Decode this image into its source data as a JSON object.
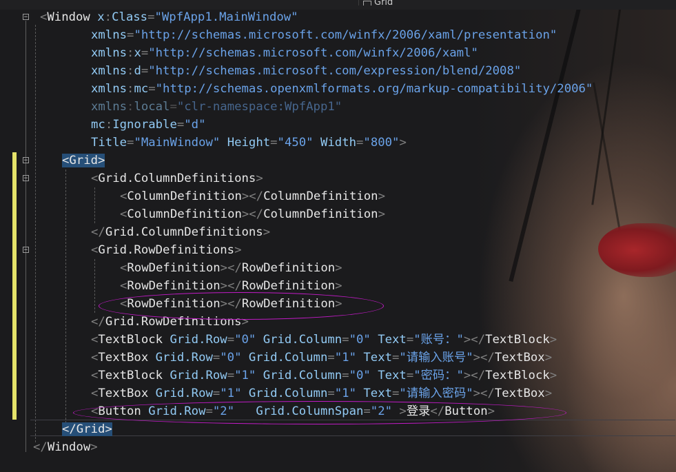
{
  "tab": {
    "icon": "grid-icon",
    "label": "Grid"
  },
  "code": [
    [
      [
        "p",
        "<"
      ],
      [
        "t",
        "Window "
      ],
      [
        "a",
        "x"
      ],
      [
        "p",
        ":"
      ],
      [
        "a",
        "Class"
      ],
      [
        "p",
        "="
      ],
      [
        "s",
        "\"WpfApp1.MainWindow\""
      ]
    ],
    [
      [
        "a",
        "xmlns"
      ],
      [
        "p",
        "="
      ],
      [
        "s",
        "\"http://schemas.microsoft.com/winfx/2006/xaml/presentation\""
      ]
    ],
    [
      [
        "a",
        "xmlns"
      ],
      [
        "p",
        ":"
      ],
      [
        "a",
        "x"
      ],
      [
        "p",
        "="
      ],
      [
        "s",
        "\"http://schemas.microsoft.com/winfx/2006/xaml\""
      ]
    ],
    [
      [
        "a",
        "xmlns"
      ],
      [
        "p",
        ":"
      ],
      [
        "a",
        "d"
      ],
      [
        "p",
        "="
      ],
      [
        "s",
        "\"http://schemas.microsoft.com/expression/blend/2008\""
      ]
    ],
    [
      [
        "a",
        "xmlns"
      ],
      [
        "p",
        ":"
      ],
      [
        "a",
        "mc"
      ],
      [
        "p",
        "="
      ],
      [
        "s",
        "\"http://schemas.openxmlformats.org/markup-compatibility/2006\""
      ]
    ],
    [
      [
        "a",
        "xmlns"
      ],
      [
        "p",
        ":"
      ],
      [
        "a",
        "local"
      ],
      [
        "p",
        "="
      ],
      [
        "s",
        "\"clr-namespace:WpfApp1\""
      ]
    ],
    [
      [
        "a",
        "mc"
      ],
      [
        "p",
        ":"
      ],
      [
        "a",
        "Ignorable"
      ],
      [
        "p",
        "="
      ],
      [
        "s",
        "\"d\""
      ]
    ],
    [
      [
        "a",
        "Title"
      ],
      [
        "p",
        "="
      ],
      [
        "s",
        "\"MainWindow\""
      ],
      [
        "a",
        " Height"
      ],
      [
        "p",
        "="
      ],
      [
        "s",
        "\"450\""
      ],
      [
        "a",
        " Width"
      ],
      [
        "p",
        "="
      ],
      [
        "s",
        "\"800\""
      ],
      [
        "p",
        ">"
      ]
    ],
    [
      [
        "hl",
        "<Grid>"
      ]
    ],
    [
      [
        "p",
        "<"
      ],
      [
        "t",
        "Grid.ColumnDefinitions"
      ],
      [
        "p",
        ">"
      ]
    ],
    [
      [
        "p",
        "<"
      ],
      [
        "t",
        "ColumnDefinition"
      ],
      [
        "p",
        "></"
      ],
      [
        "t",
        "ColumnDefinition"
      ],
      [
        "p",
        ">"
      ]
    ],
    [
      [
        "p",
        "<"
      ],
      [
        "t",
        "ColumnDefinition"
      ],
      [
        "p",
        "></"
      ],
      [
        "t",
        "ColumnDefinition"
      ],
      [
        "p",
        ">"
      ]
    ],
    [
      [
        "p",
        "</"
      ],
      [
        "t",
        "Grid.ColumnDefinitions"
      ],
      [
        "p",
        ">"
      ]
    ],
    [
      [
        "p",
        "<"
      ],
      [
        "t",
        "Grid.RowDefinitions"
      ],
      [
        "p",
        ">"
      ]
    ],
    [
      [
        "p",
        "<"
      ],
      [
        "t",
        "RowDefinition"
      ],
      [
        "p",
        "></"
      ],
      [
        "t",
        "RowDefinition"
      ],
      [
        "p",
        ">"
      ]
    ],
    [
      [
        "p",
        "<"
      ],
      [
        "t",
        "RowDefinition"
      ],
      [
        "p",
        "></"
      ],
      [
        "t",
        "RowDefinition"
      ],
      [
        "p",
        ">"
      ]
    ],
    [
      [
        "p",
        "<"
      ],
      [
        "t",
        "RowDefinition"
      ],
      [
        "p",
        "></"
      ],
      [
        "t",
        "RowDefinition"
      ],
      [
        "p",
        ">"
      ]
    ],
    [
      [
        "p",
        "</"
      ],
      [
        "t",
        "Grid.RowDefinitions"
      ],
      [
        "p",
        ">"
      ]
    ],
    [
      [
        "p",
        "<"
      ],
      [
        "t",
        "TextBlock "
      ],
      [
        "a",
        "Grid.Row"
      ],
      [
        "p",
        "="
      ],
      [
        "s",
        "\"0\""
      ],
      [
        "a",
        " Grid.Column"
      ],
      [
        "p",
        "="
      ],
      [
        "s",
        "\"0\""
      ],
      [
        "a",
        " Text"
      ],
      [
        "p",
        "="
      ],
      [
        "s",
        "\"账号：\""
      ],
      [
        "p",
        "></"
      ],
      [
        "t",
        "TextBlock"
      ],
      [
        "p",
        ">"
      ]
    ],
    [
      [
        "p",
        "<"
      ],
      [
        "t",
        "TextBox "
      ],
      [
        "a",
        "Grid.Row"
      ],
      [
        "p",
        "="
      ],
      [
        "s",
        "\"0\""
      ],
      [
        "a",
        " Grid.Column"
      ],
      [
        "p",
        "="
      ],
      [
        "s",
        "\"1\""
      ],
      [
        "a",
        " Text"
      ],
      [
        "p",
        "="
      ],
      [
        "s",
        "\"请输入账号\""
      ],
      [
        "p",
        "></"
      ],
      [
        "t",
        "TextBox"
      ],
      [
        "p",
        ">"
      ]
    ],
    [
      [
        "p",
        "<"
      ],
      [
        "t",
        "TextBlock "
      ],
      [
        "a",
        "Grid.Row"
      ],
      [
        "p",
        "="
      ],
      [
        "s",
        "\"1\""
      ],
      [
        "a",
        " Grid.Column"
      ],
      [
        "p",
        "="
      ],
      [
        "s",
        "\"0\""
      ],
      [
        "a",
        " Text"
      ],
      [
        "p",
        "="
      ],
      [
        "s",
        "\"密码：\""
      ],
      [
        "p",
        "></"
      ],
      [
        "t",
        "TextBlock"
      ],
      [
        "p",
        ">"
      ]
    ],
    [
      [
        "p",
        "<"
      ],
      [
        "t",
        "TextBox "
      ],
      [
        "a",
        "Grid.Row"
      ],
      [
        "p",
        "="
      ],
      [
        "s",
        "\"1\""
      ],
      [
        "a",
        " Grid.Column"
      ],
      [
        "p",
        "="
      ],
      [
        "s",
        "\"1\""
      ],
      [
        "a",
        " Text"
      ],
      [
        "p",
        "="
      ],
      [
        "s",
        "\"请输入密码\""
      ],
      [
        "p",
        "></"
      ],
      [
        "t",
        "TextBox"
      ],
      [
        "p",
        ">"
      ]
    ],
    [
      [
        "p",
        "<"
      ],
      [
        "t",
        "Button "
      ],
      [
        "a",
        "Grid.Row"
      ],
      [
        "p",
        "="
      ],
      [
        "s",
        "\"2\""
      ],
      [
        "a",
        "   Grid.ColumnSpan"
      ],
      [
        "p",
        "="
      ],
      [
        "s",
        "\"2\""
      ],
      [
        "p",
        " >"
      ],
      [
        "t",
        "登录"
      ],
      [
        "p",
        "</"
      ],
      [
        "t",
        "Button"
      ],
      [
        "p",
        ">"
      ]
    ],
    [
      [
        "hl",
        "</Grid>"
      ]
    ],
    [
      [
        "p",
        "</"
      ],
      [
        "t",
        "Window"
      ],
      [
        "p",
        ">"
      ]
    ]
  ],
  "fold_icons": [
    "collapse-icon",
    "collapse-icon",
    "collapse-icon",
    "collapse-icon"
  ],
  "colors": {
    "punctuation": "#808080",
    "element": "#e6e6e6",
    "attribute": "#92caf4",
    "string": "#6aa2e8",
    "highlight": "#264f78",
    "annotation": "#c21bc7",
    "change_bar": "#e5e36a"
  }
}
